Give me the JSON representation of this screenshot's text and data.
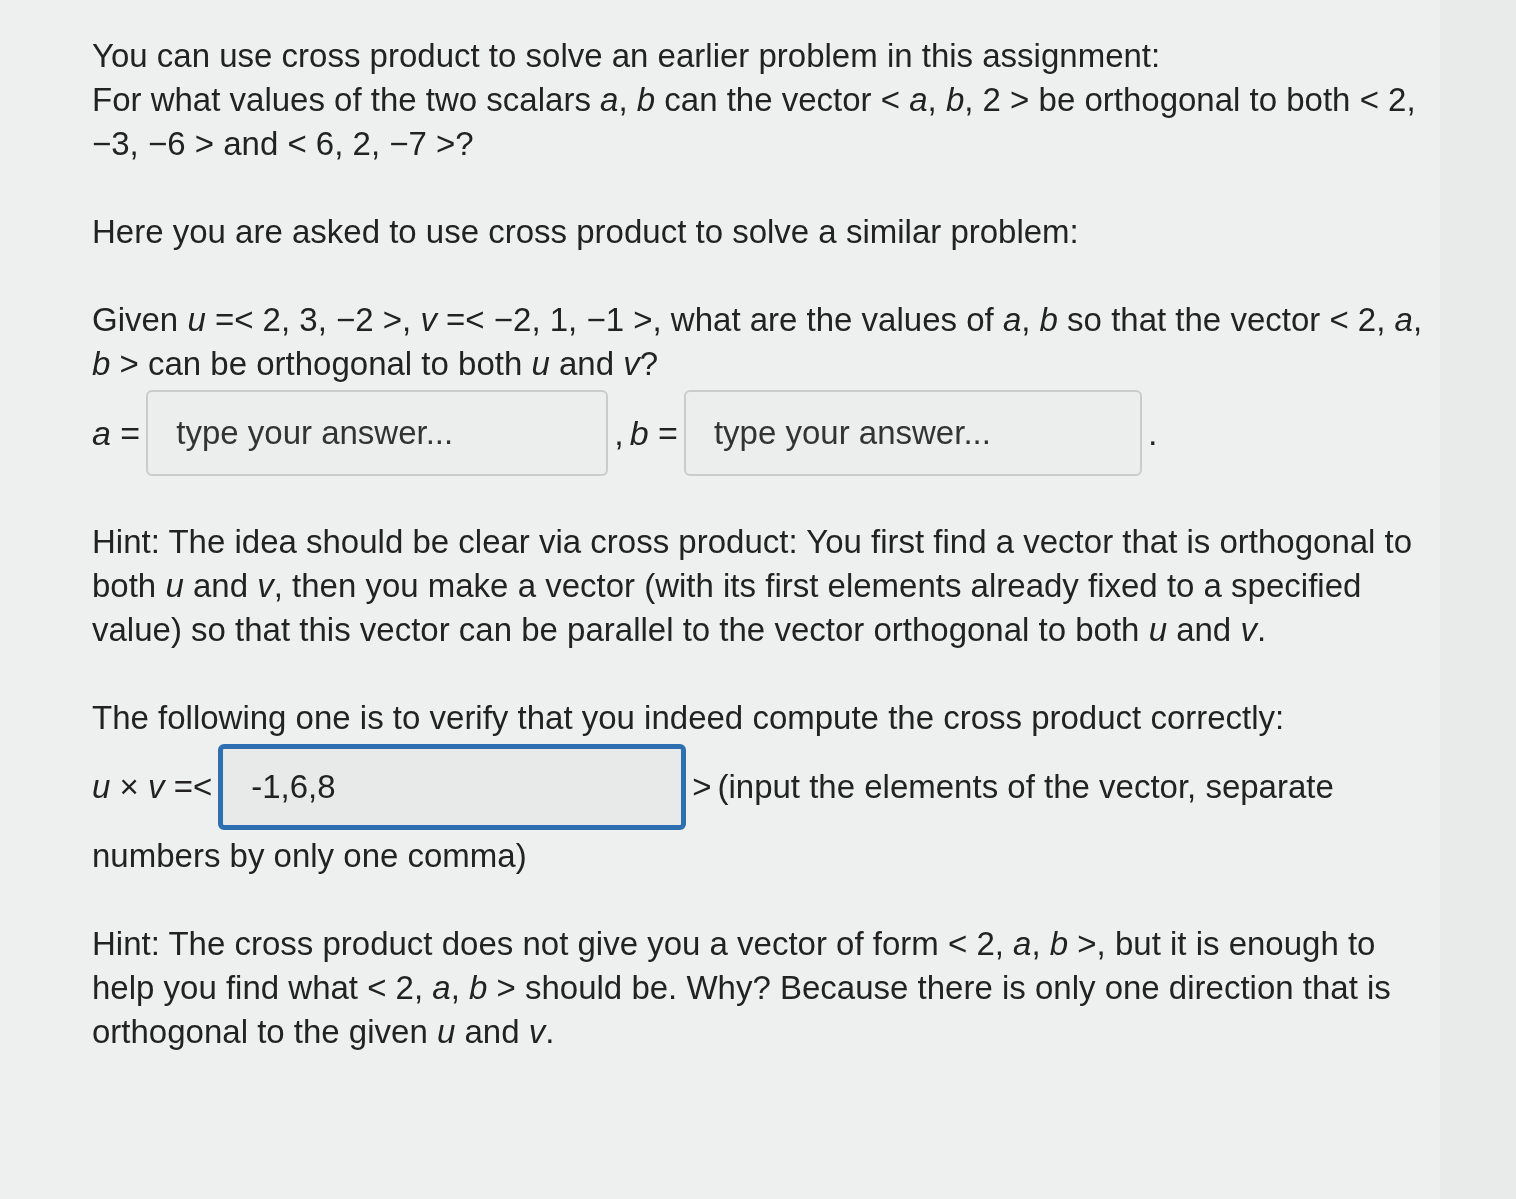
{
  "intro": [
    "You can use cross product to solve an earlier problem in this assignment:",
    "For what values of the two scalars *a*, *b* can the vector < *a*, *b*, 2 > be orthogonal to both < 2, −3, −6 > and < 6, 2, −7 >?"
  ],
  "lead": "Here you are asked to use cross product to solve a similar problem:",
  "question": "Given *u* =< 2, 3, −2 >, *v* =< −2, 1, −1 >, what are the values of *a*, *b* so that the vector < 2, *a*, *b* > can be orthogonal to both *u* and *v*?",
  "answers": {
    "a_label": "*a* =",
    "a_field": {
      "placeholder": "type your answer...",
      "focused": false
    },
    "separator": ",",
    "b_label": "*b* =",
    "b_field": {
      "placeholder": "type your answer...",
      "focused": false
    },
    "end": "."
  },
  "hint_1": "Hint: The idea should be clear via cross product: You first find a vector that is orthogonal to both *u* and *v*, then you make a vector (with its first elements already fixed to a specified value) so that this vector can be parallel to the vector orthogonal to both *u* and *v*.",
  "verify": {
    "text": "The following one is to verify that you indeed compute the cross product correctly:",
    "label": "*u* × *v* =<",
    "field": {
      "value": "-1,6,8",
      "focused": true
    },
    "close": ">",
    "note": [
      "(input the elements of the vector, separate",
      "numbers by only one comma)"
    ]
  },
  "hint_2": "Hint: The cross product does not give you a vector of form < 2, *a*, *b* >, but it is enough to help you find what < 2, *a*, *b* > should be. Why? Because there is only one direction that is orthogonal to the given *u* and *v*."
}
